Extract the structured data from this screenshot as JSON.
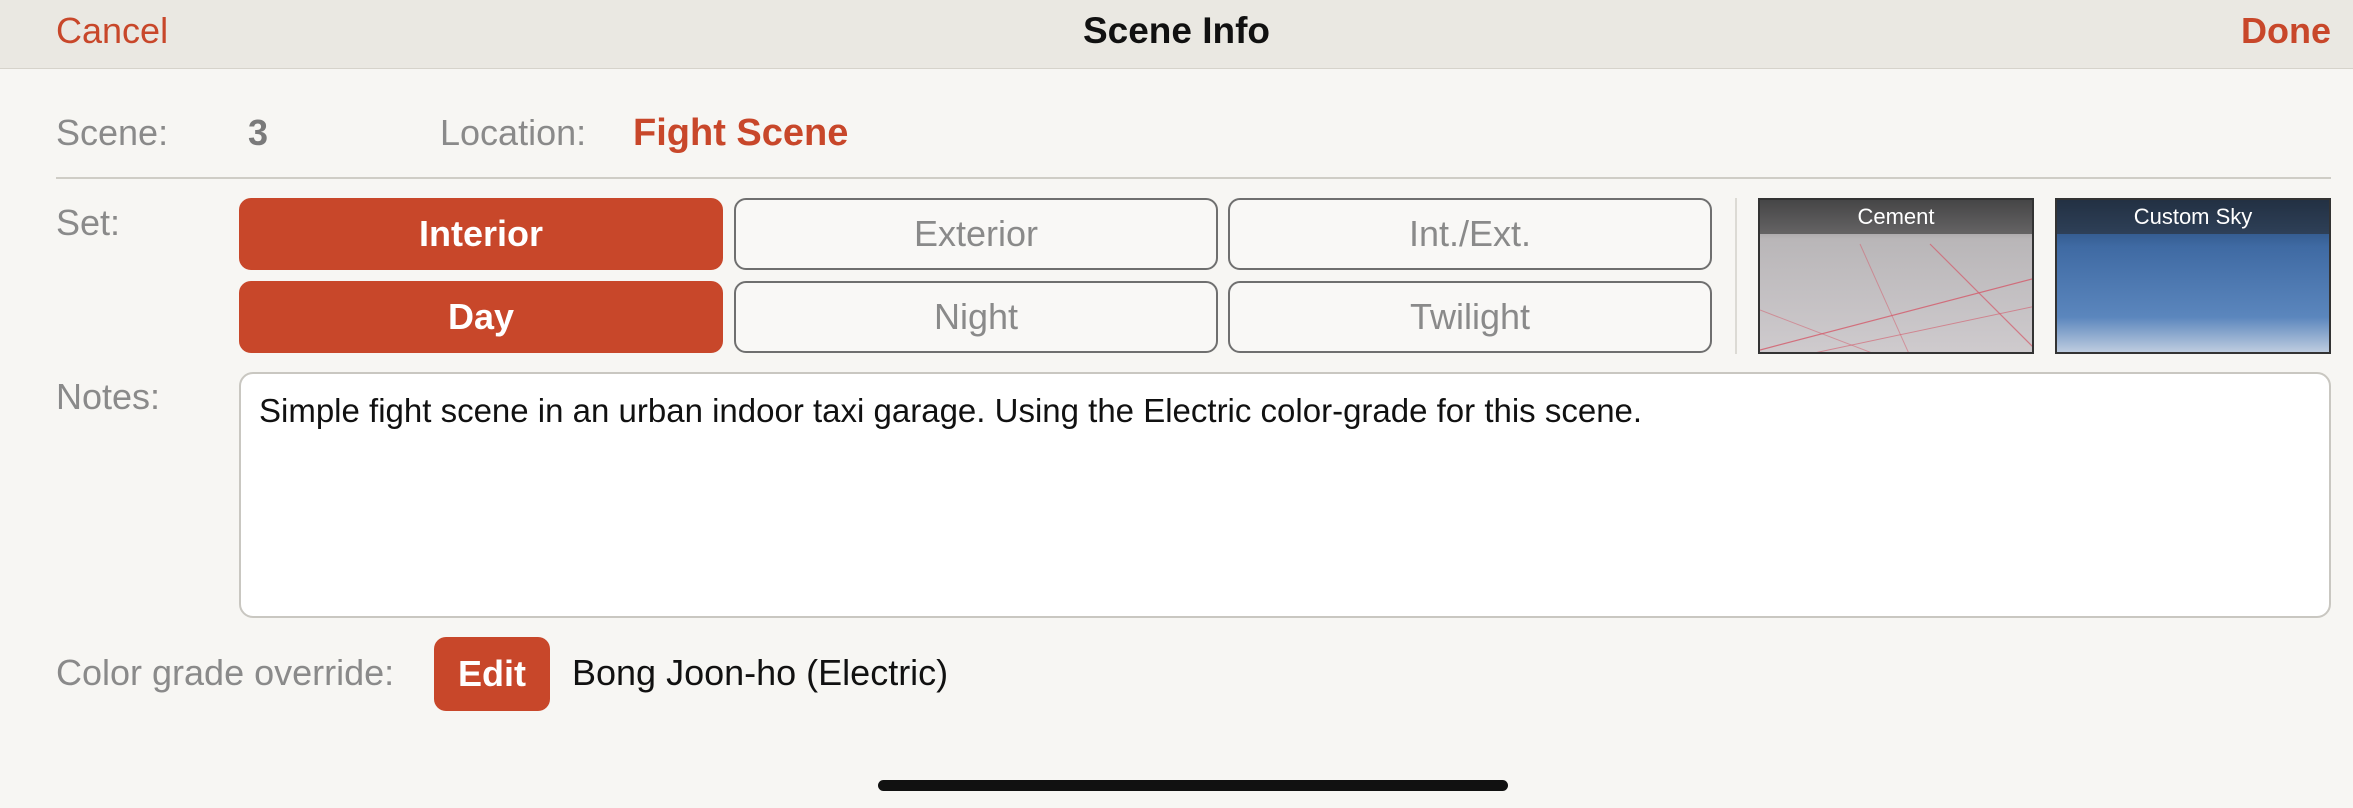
{
  "navbar": {
    "cancel_label": "Cancel",
    "title": "Scene Info",
    "done_label": "Done"
  },
  "scene": {
    "label": "Scene:",
    "number": "3"
  },
  "location": {
    "label": "Location:",
    "value": "Fight Scene"
  },
  "set": {
    "label": "Set:",
    "setting_options": [
      {
        "label": "Interior",
        "selected": true
      },
      {
        "label": "Exterior",
        "selected": false
      },
      {
        "label": "Int./Ext.",
        "selected": false
      }
    ],
    "time_options": [
      {
        "label": "Day",
        "selected": true
      },
      {
        "label": "Night",
        "selected": false
      },
      {
        "label": "Twilight",
        "selected": false
      }
    ],
    "environment_thumbnails": [
      {
        "label": "Cement"
      },
      {
        "label": "Custom Sky"
      }
    ]
  },
  "notes": {
    "label": "Notes:",
    "text": "Simple fight scene in an urban indoor taxi garage.  Using the Electric color-grade for this scene."
  },
  "color_grade": {
    "label": "Color grade override:",
    "edit_label": "Edit",
    "value": "Bong Joon-ho (Electric)"
  },
  "colors": {
    "accent": "#c8472a",
    "background": "#f7f6f3",
    "navbar": "#eae8e2"
  }
}
